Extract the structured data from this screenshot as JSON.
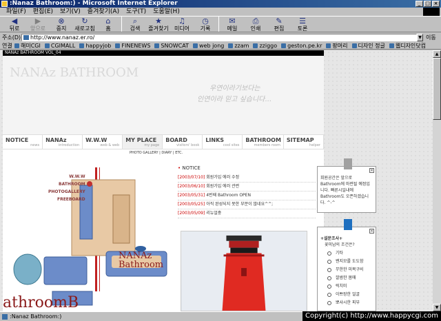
{
  "window": {
    "title": ":Nanaz Bathroom:) - Microsoft Internet Explorer",
    "minimize": "_",
    "maximize": "□",
    "close": "×"
  },
  "menu": [
    "파일(F)",
    "편집(E)",
    "보기(V)",
    "즐겨찾기(A)",
    "도구(T)",
    "도움말(H)"
  ],
  "toolbar": {
    "back": "뒤로",
    "forward": "앞으로",
    "stop": "중지",
    "refresh": "새로고침",
    "home": "홈",
    "search": "검색",
    "favorites": "즐겨찾기",
    "media": "미디어",
    "history": "기록",
    "mail": "메일",
    "print": "인쇄",
    "edit": "편집",
    "discuss": "토론"
  },
  "address": {
    "label": "주소(D)",
    "url": "http://www.nanaz.er.ro/",
    "go": "이동"
  },
  "links": {
    "label": "연결",
    "items": [
      "해미CGI",
      "CGIMALL",
      "happyjob",
      "FINENEWS",
      "SNOWCAT",
      "web jong",
      "zzam",
      "zziggo",
      "geston.pe.kr",
      "팡머리",
      "디자인 정글",
      "웹디자인닷컴"
    ]
  },
  "site": {
    "header": "NANAz BATHROOM VOL_04",
    "brand": "NANAz BATHROOM",
    "slogan_line1": "우연이라기보다는",
    "slogan_line2": "인연이라 믿고 싶습니다...",
    "nav": [
      {
        "main": "NOTICE",
        "sub": "news"
      },
      {
        "main": "NANAz",
        "sub": "introduction"
      },
      {
        "main": "W.W.W",
        "sub": "web & web"
      },
      {
        "main": "MY PLACE",
        "sub": "my page"
      },
      {
        "main": "BOARD",
        "sub": "visitors' book"
      },
      {
        "main": "LINKS",
        "sub": "cool sites"
      },
      {
        "main": "BATHROOM",
        "sub": "members room"
      },
      {
        "main": "SITEMAP",
        "sub": "helper"
      }
    ],
    "subnav": "PHOTO GALLERY | DIARY | ETC.",
    "left_menu": [
      "W.W.W",
      "BATHROOM",
      "PHOTOGALLERY",
      "FREEBOARD"
    ],
    "nanaz_big_line1": "NANAz",
    "nanaz_big_line2": "Bathroom",
    "bathroom_script": "athroomB",
    "notice_title": "NOTICE",
    "notices": [
      {
        "date": "[2003/07/10]",
        "text": "회원가입 에러 수정"
      },
      {
        "date": "[2003/06/10]",
        "text": "회원가입 에러 관련"
      },
      {
        "date": "[2003/05/31]",
        "text": "4번째 Bathroom OPEN"
      },
      {
        "date": "[2003/05/25]",
        "text": "아직 완성되지 못한 부분이 많네요^^;"
      },
      {
        "date": "[2003/05/09]",
        "text": "리뉴얼중"
      }
    ]
  },
  "popup1": {
    "close": "×",
    "text": "회원공간은 앞으로 Bathroom에 마련될 예정입니다. 빠른시일내에 Bathroom도 오픈하겠습니다. ^-^"
  },
  "popup2": {
    "close": "×",
    "title": "+설문조사+",
    "question": "꽃미남의 조건은?",
    "options": [
      "기타",
      "왠지모를 도도함",
      "무한한 미목구비",
      "깔쌈한 몸매",
      "럭치미",
      "이쁘장한 얼굴",
      "뽀샤시한 피부"
    ]
  },
  "status": {
    "text": ":Nanaz Bathroom:)"
  },
  "copyright": "Copyright(c) http://www.happycgi.com"
}
